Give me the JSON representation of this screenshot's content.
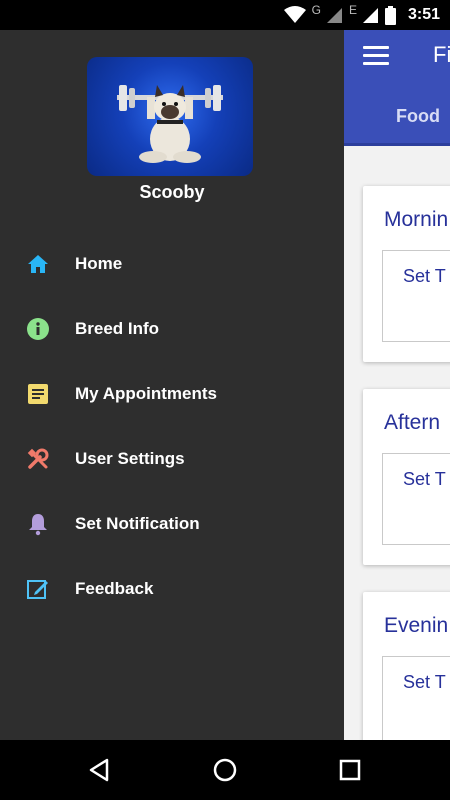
{
  "status_bar": {
    "network_letters": [
      "G",
      "E"
    ],
    "time": "3:51"
  },
  "app": {
    "toolbar_title": "Fi",
    "tab_food": "Food",
    "cards": [
      {
        "title": "Mornin",
        "time_placeholder": "Set T"
      },
      {
        "title": "Aftern",
        "time_placeholder": "Set T"
      },
      {
        "title": "Evenin",
        "time_placeholder": "Set T"
      }
    ]
  },
  "drawer": {
    "user_name": "Scooby",
    "items": [
      {
        "label": "Home",
        "icon": "home-icon",
        "color": "#29b6f6"
      },
      {
        "label": "Breed Info",
        "icon": "info-icon",
        "color": "#8be28b"
      },
      {
        "label": "My Appointments",
        "icon": "notes-icon",
        "color": "#f2da6e"
      },
      {
        "label": "User Settings",
        "icon": "tools-icon",
        "color": "#f07a6a"
      },
      {
        "label": "Set Notification",
        "icon": "bell-icon",
        "color": "#b39ddb"
      },
      {
        "label": "Feedback",
        "icon": "edit-icon",
        "color": "#4fc3f7"
      }
    ]
  },
  "colors": {
    "drawer_bg": "#2e2e2e",
    "app_bar": "#3a4fb8",
    "card_text": "#27319a"
  }
}
